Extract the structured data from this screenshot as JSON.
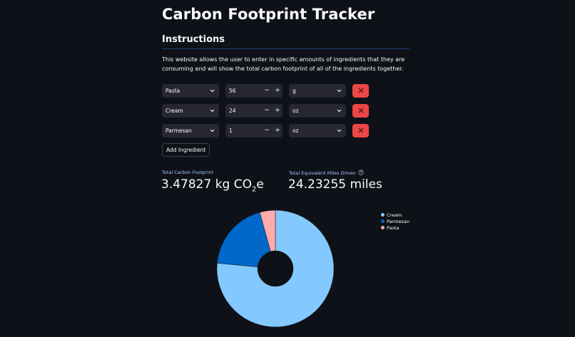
{
  "header": {
    "title": "Carbon Footprint Tracker",
    "subheader": "Instructions",
    "description": "This website allows the user to enter in specific amounts of ingredients that they are consuming and will show the total carbon footprint of all of the ingredients together."
  },
  "ingredients": [
    {
      "name": "Pasta",
      "amount": "56",
      "unit": "g"
    },
    {
      "name": "Cream",
      "amount": "24",
      "unit": "oz"
    },
    {
      "name": "Parmesan",
      "amount": "1",
      "unit": "oz"
    }
  ],
  "controls": {
    "minus": "−",
    "plus": "+",
    "add_ingredient": "Add Ingredient"
  },
  "metrics": {
    "footprint_label": "Total Carbon Footprint",
    "footprint_value": "3.47827 kg CO",
    "footprint_sub": "2",
    "footprint_suffix": "e",
    "miles_label": "Total Equivalent Miles Driven",
    "miles_value": "24.23255 miles"
  },
  "chart_data": {
    "type": "pie",
    "categories": [
      "Cream",
      "Parmesan",
      "Pasta"
    ],
    "values": [
      76.5,
      19.2,
      4.3
    ],
    "colors": [
      "#83c9ff",
      "#0068c9",
      "#ffabab"
    ],
    "donut": true,
    "legend": "top-right"
  },
  "colors": {
    "background": "#0e1117",
    "input_bg": "#262730",
    "delete_button": "#ff4b4b",
    "metric_label": "#a9c7ff"
  }
}
